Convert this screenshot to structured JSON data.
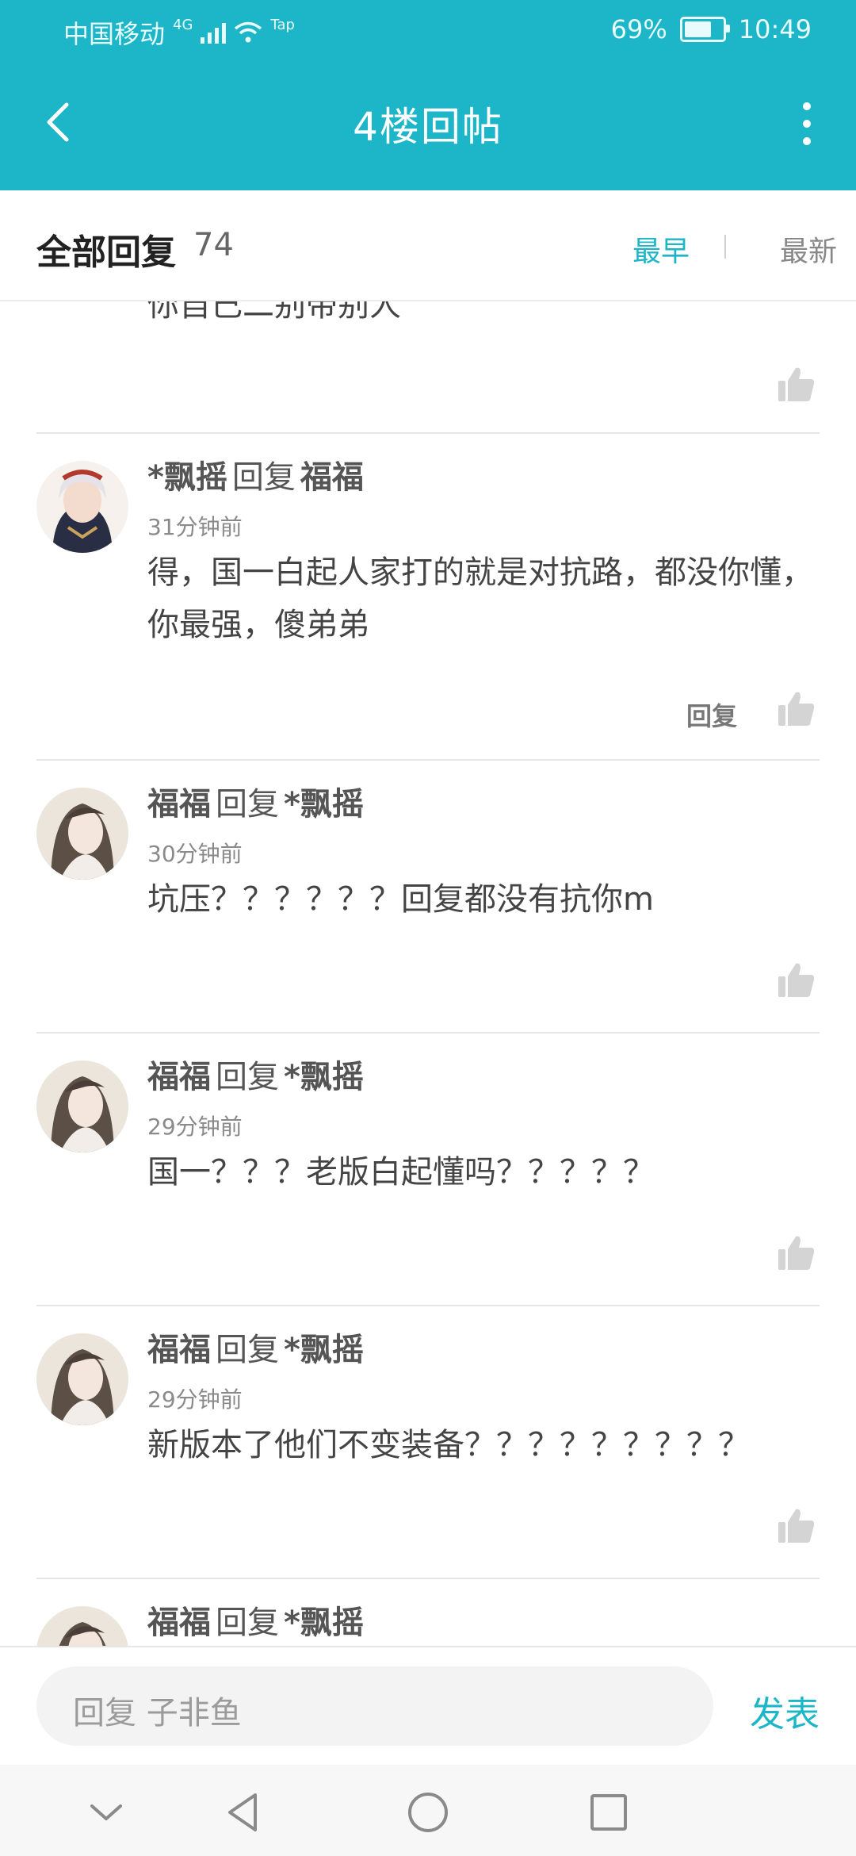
{
  "status_bar": {
    "carrier": "中国移动",
    "network": "4G",
    "extra": "Tap",
    "battery": "69%",
    "time": "10:49"
  },
  "header": {
    "title": "4楼回帖"
  },
  "sort": {
    "label": "全部回复",
    "count": "74",
    "earliest": "最早",
    "latest": "最新"
  },
  "partial_text": "你自己二别带别人",
  "replies": [
    {
      "user": "*飘摇",
      "reply_word": "回复",
      "target": "福福",
      "time": "31分钟前",
      "content": "得，国一白起人家打的就是对抗路，都没你懂，你最强，傻弟弟",
      "reply_label": "回复"
    },
    {
      "user": "福福",
      "reply_word": "回复",
      "target": "*飘摇",
      "time": "30分钟前",
      "content": "坑压？？？？？？回复都没有抗你m"
    },
    {
      "user": "福福",
      "reply_word": "回复",
      "target": "*飘摇",
      "time": "29分钟前",
      "content": "国一？？？老版白起懂吗？？？？？"
    },
    {
      "user": "福福",
      "reply_word": "回复",
      "target": "*飘摇",
      "time": "29分钟前",
      "content": "新版本了他们不变装备？？？？？？？？？"
    },
    {
      "user": "福福",
      "reply_word": "回复",
      "target": "*飘摇"
    }
  ],
  "input": {
    "placeholder": "回复 子非鱼",
    "send": "发表"
  },
  "colors": {
    "accent": "#1cb6c8"
  }
}
